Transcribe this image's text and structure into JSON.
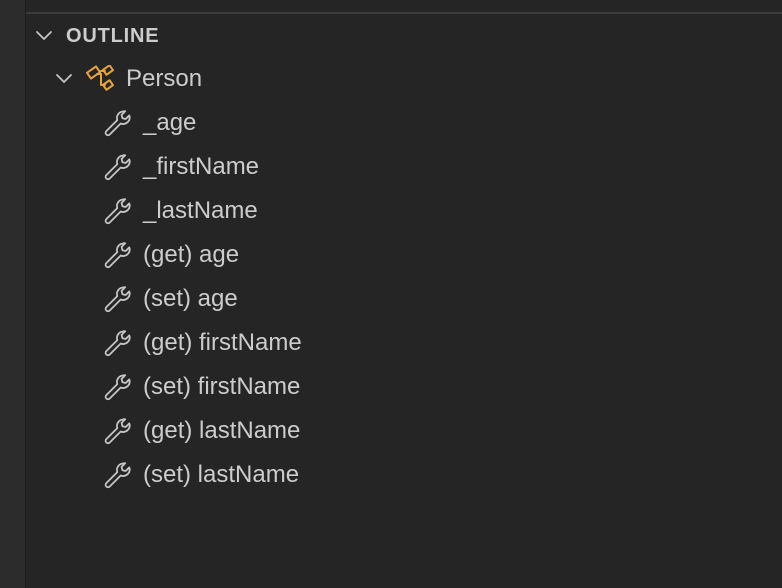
{
  "outline": {
    "section_title": "OUTLINE",
    "class_item": {
      "label": "Person",
      "icon": "class-icon",
      "color": "#e8a33b"
    },
    "members": [
      {
        "label": "_age",
        "icon": "wrench-icon"
      },
      {
        "label": "_firstName",
        "icon": "wrench-icon"
      },
      {
        "label": "_lastName",
        "icon": "wrench-icon"
      },
      {
        "label": "(get) age",
        "icon": "wrench-icon"
      },
      {
        "label": "(set) age",
        "icon": "wrench-icon"
      },
      {
        "label": "(get) firstName",
        "icon": "wrench-icon"
      },
      {
        "label": "(set) firstName",
        "icon": "wrench-icon"
      },
      {
        "label": "(get) lastName",
        "icon": "wrench-icon"
      },
      {
        "label": "(set) lastName",
        "icon": "wrench-icon"
      }
    ]
  }
}
